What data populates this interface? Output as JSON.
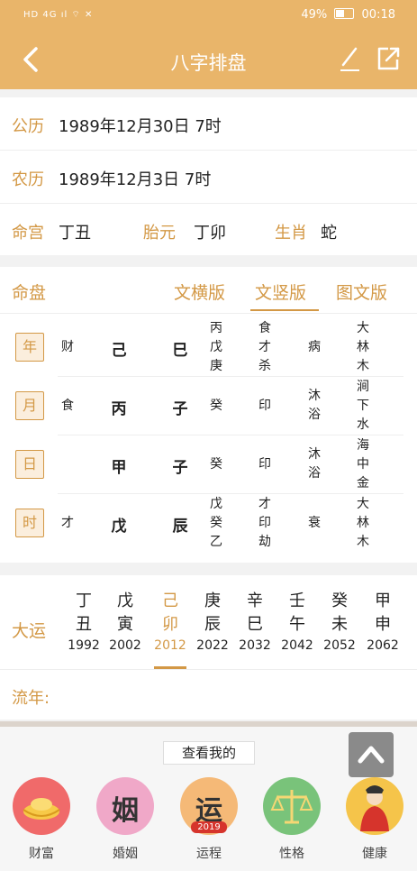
{
  "status": {
    "left": "HD 4G ıl ⌔ ✕",
    "battery": "49%",
    "time": "00:18"
  },
  "nav": {
    "title": "八字排盘"
  },
  "info": {
    "gongli_label": "公历",
    "gongli_value": "1989年12月30日 7时",
    "nongli_label": "农历",
    "nongli_value": "1989年12月3日 7时",
    "minggong_label": "命宫",
    "minggong_value": "丁丑",
    "taiyuan_label": "胎元",
    "taiyuan_value": "丁卯",
    "shengxiao_label": "生肖",
    "shengxiao_value": "蛇"
  },
  "mingpan": {
    "label": "命盘",
    "tabs": [
      "文横版",
      "文竖版",
      "图文版"
    ],
    "selected_tab": "文竖版",
    "rows": [
      {
        "pillar": "年",
        "shishen": "财",
        "gan": "己",
        "zhi": "巳",
        "canggan": [
          "丙",
          "戊",
          "庚"
        ],
        "fushen": [
          "食",
          "才",
          "杀"
        ],
        "state": [
          "病"
        ],
        "nayin": [
          "大",
          "林",
          "木"
        ]
      },
      {
        "pillar": "月",
        "shishen": "食",
        "gan": "丙",
        "zhi": "子",
        "canggan": [
          "癸"
        ],
        "fushen": [
          "印"
        ],
        "state": [
          "沐",
          "浴"
        ],
        "nayin": [
          "涧",
          "下",
          "水"
        ]
      },
      {
        "pillar": "日",
        "shishen": "",
        "gan": "甲",
        "zhi": "子",
        "canggan": [
          "癸"
        ],
        "fushen": [
          "印"
        ],
        "state": [
          "沐",
          "浴"
        ],
        "nayin": [
          "海",
          "中",
          "金"
        ]
      },
      {
        "pillar": "时",
        "shishen": "才",
        "gan": "戊",
        "zhi": "辰",
        "canggan": [
          "戊",
          "癸",
          "乙"
        ],
        "fushen": [
          "才",
          "印",
          "劫"
        ],
        "state": [
          "衰"
        ],
        "nayin": [
          "大",
          "林",
          "木"
        ]
      }
    ]
  },
  "dayun": {
    "label": "大运",
    "items": [
      {
        "gan": "丁",
        "zhi": "丑",
        "year": "1992"
      },
      {
        "gan": "戊",
        "zhi": "寅",
        "year": "2002"
      },
      {
        "gan": "己",
        "zhi": "卯",
        "year": "2012"
      },
      {
        "gan": "庚",
        "zhi": "辰",
        "year": "2022"
      },
      {
        "gan": "辛",
        "zhi": "巳",
        "year": "2032"
      },
      {
        "gan": "壬",
        "zhi": "午",
        "year": "2042"
      },
      {
        "gan": "癸",
        "zhi": "未",
        "year": "2052"
      },
      {
        "gan": "甲",
        "zhi": "申",
        "year": "2062"
      }
    ],
    "selected_index": 2
  },
  "liunian": {
    "label": "流年:"
  },
  "bottom": {
    "look_label": "查看我的",
    "icons": [
      {
        "label": "财富",
        "glyph": "",
        "color": "#f06a6a"
      },
      {
        "label": "婚姻",
        "glyph": "姻",
        "color": "#f0a8c8"
      },
      {
        "label": "运程",
        "glyph": "运",
        "sub": "2019",
        "color": "#f5b977"
      },
      {
        "label": "性格",
        "glyph": "",
        "color": "#79c37a"
      },
      {
        "label": "健康",
        "glyph": "",
        "color": "#f5c44a"
      }
    ]
  },
  "colors": {
    "accent": "#e9b56a",
    "label": "#d39845"
  }
}
